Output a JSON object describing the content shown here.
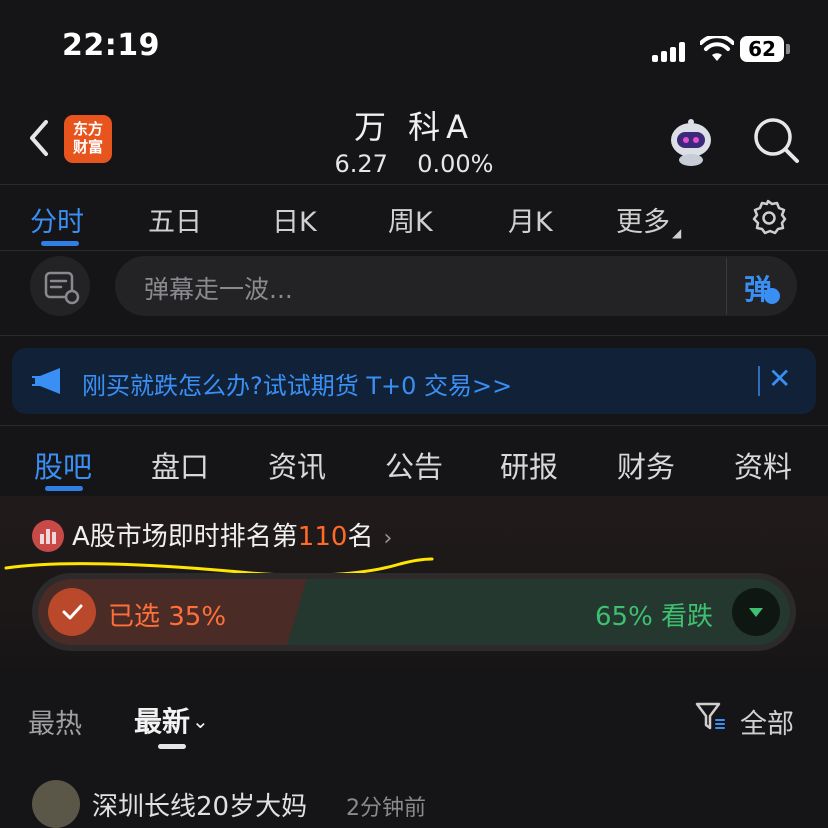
{
  "status_bar": {
    "time": "22:19",
    "battery": "62"
  },
  "nav": {
    "logo_line1": "东方",
    "logo_line2": "财富",
    "title": "万 科A",
    "price": "6.27",
    "change": "0.00%"
  },
  "chart_tabs": [
    "分时",
    "五日",
    "日K",
    "周K",
    "月K",
    "更多"
  ],
  "danmu": {
    "placeholder": "弹幕走一波...",
    "button": "弹"
  },
  "promo": {
    "text": "刚买就跌怎么办?试试期货 T+0 交易>>"
  },
  "content_tabs": [
    "股吧",
    "盘口",
    "资讯",
    "公告",
    "研报",
    "财务",
    "资料"
  ],
  "ranking": {
    "prefix": "A股市场即时排名第",
    "rank": "110",
    "suffix": "名"
  },
  "vote": {
    "left_label": "已选 35%",
    "right_label": "65% 看跌",
    "bullish_pct": 35,
    "bearish_pct": 65
  },
  "sort": {
    "hot": "最热",
    "new": "最新",
    "filter": "全部"
  },
  "post_preview": {
    "author": "深圳长线20岁大妈",
    "time": "2分钟前"
  },
  "colors": {
    "accent": "#3a8ff5",
    "up": "#ff6f3a",
    "down": "#3fbf70",
    "brand": "#e8541e"
  }
}
